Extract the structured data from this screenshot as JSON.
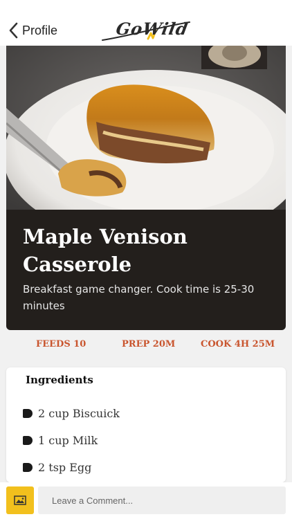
{
  "nav": {
    "back_label": "Profile",
    "logo_text": "GoWild"
  },
  "recipe": {
    "title": "Maple Venison Casserole",
    "description": "Breakfast game changer. Cook time is 25-30 minutes"
  },
  "stats": {
    "feeds": "FEEDS 10",
    "prep": "PREP 20M",
    "cook": "COOK 4H 25M"
  },
  "ingredients": {
    "title": "Ingredients",
    "items": [
      "2 cup Biscuick",
      "1 cup Milk",
      "2 tsp Egg"
    ]
  },
  "comment": {
    "placeholder": "Leave a Comment..."
  },
  "colors": {
    "accent": "#c9552e",
    "image_button": "#f2c01d",
    "card_background": "#231f1c",
    "status_indicator": "#4cd964"
  },
  "icons": [
    "back-chevron-icon",
    "image-icon",
    "bullet-icon"
  ]
}
